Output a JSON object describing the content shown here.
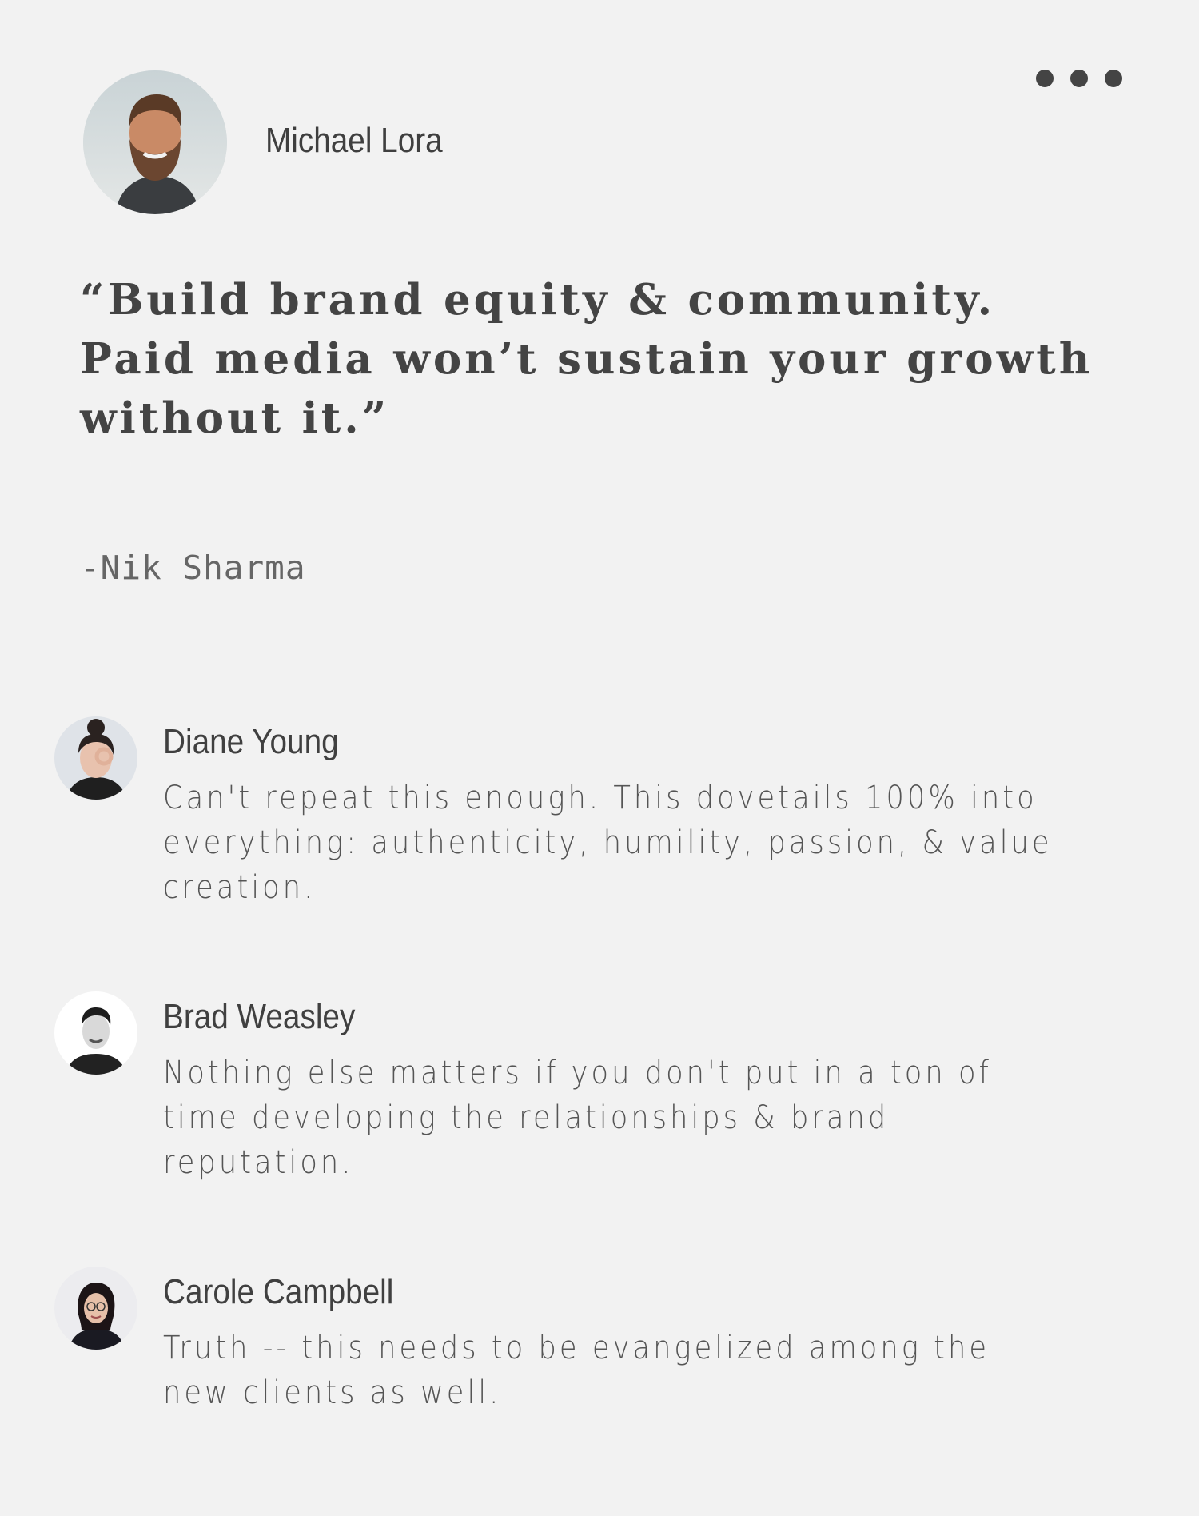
{
  "post": {
    "author": {
      "name": "Michael Lora",
      "avatar_icon": "bearded-man-photo"
    },
    "more_menu": {
      "icon": "more-dots-icon"
    },
    "quote": {
      "text": "“Build brand equity & community. Paid media won’t sustain your growth without it.”",
      "attribution": "-Nik Sharma"
    }
  },
  "comments": [
    {
      "author": "Diane Young",
      "text": "Can't repeat this enough. This dovetails 100% into everything: authenticity, humility, passion, & value creation.",
      "avatar_icon": "woman-with-bun-photo"
    },
    {
      "author": "Brad Weasley",
      "text": "Nothing else matters if you don't put in a ton of time developing the relationships & brand reputation.",
      "avatar_icon": "smiling-man-photo"
    },
    {
      "author": "Carole Campbell",
      "text": "Truth -- this needs to be evangelized among the new clients as well.",
      "avatar_icon": "woman-with-glasses-photo"
    }
  ],
  "colors": {
    "background": "#f2f2f2",
    "text_primary": "#444444",
    "text_secondary": "#555555"
  }
}
